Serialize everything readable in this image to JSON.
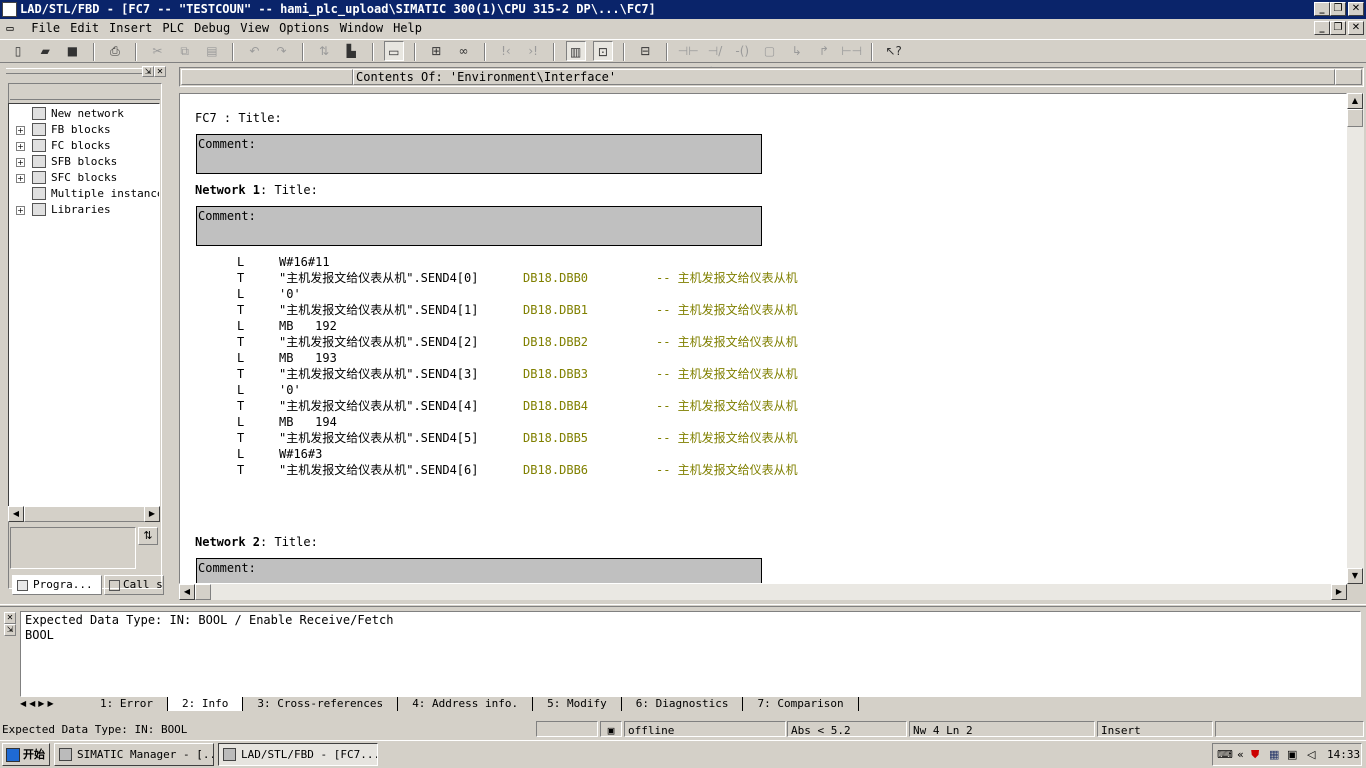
{
  "window": {
    "title": "LAD/STL/FBD  - [FC7 -- \"TESTCOUN\" -- hami_plc_upload\\SIMATIC 300(1)\\CPU 315-2 DP\\...\\FC7]"
  },
  "menu": {
    "items": [
      "File",
      "Edit",
      "Insert",
      "PLC",
      "Debug",
      "View",
      "Options",
      "Window",
      "Help"
    ]
  },
  "toolbar": {
    "icons": [
      "new-icon",
      "open-icon",
      "save-icon",
      "print-icon",
      "cut-icon",
      "copy-icon",
      "paste-icon",
      "undo-icon",
      "redo-icon",
      "load-icon",
      "download-icon",
      "overview-icon",
      "network-icon",
      "monitor-icon",
      "first-error-icon",
      "next-error-icon",
      "details-icon",
      "program-elements-icon",
      "new-network-icon",
      "contact-icon",
      "nc-contact-icon",
      "coil-icon",
      "branch-open-icon",
      "branch-close-icon",
      "connection-icon",
      "help-icon"
    ]
  },
  "tree": {
    "items": [
      {
        "label": "New network",
        "expandable": false
      },
      {
        "label": "FB blocks",
        "expandable": true
      },
      {
        "label": "FC blocks",
        "expandable": true
      },
      {
        "label": "SFB blocks",
        "expandable": true
      },
      {
        "label": "SFC blocks",
        "expandable": true
      },
      {
        "label": "Multiple instances",
        "expandable": false
      },
      {
        "label": "Libraries",
        "expandable": true
      }
    ],
    "tabs": [
      "Progra...",
      "Call s"
    ]
  },
  "interface_header": "Contents Of: 'Environment\\Interface'",
  "editor": {
    "block_title": "FC7 : Title:",
    "comment_label": "Comment:",
    "network1": {
      "label": "Network 1",
      "title": ": Title:"
    },
    "network2": {
      "label": "Network 2",
      "title": ": Title:"
    },
    "lines": [
      {
        "op": "L",
        "operand": "W#16#11",
        "address": "",
        "comment": ""
      },
      {
        "op": "T",
        "operand": "\"主机发报文给仪表从机\".SEND4[0]",
        "address": "DB18.DBB0",
        "comment": "-- 主机发报文给仪表从机"
      },
      {
        "op": "L",
        "operand": "'0'",
        "address": "",
        "comment": ""
      },
      {
        "op": "T",
        "operand": "\"主机发报文给仪表从机\".SEND4[1]",
        "address": "DB18.DBB1",
        "comment": "-- 主机发报文给仪表从机"
      },
      {
        "op": "L",
        "operand": "MB   192",
        "address": "",
        "comment": ""
      },
      {
        "op": "T",
        "operand": "\"主机发报文给仪表从机\".SEND4[2]",
        "address": "DB18.DBB2",
        "comment": "-- 主机发报文给仪表从机"
      },
      {
        "op": "L",
        "operand": "MB   193",
        "address": "",
        "comment": ""
      },
      {
        "op": "T",
        "operand": "\"主机发报文给仪表从机\".SEND4[3]",
        "address": "DB18.DBB3",
        "comment": "-- 主机发报文给仪表从机"
      },
      {
        "op": "L",
        "operand": "'0'",
        "address": "",
        "comment": ""
      },
      {
        "op": "T",
        "operand": "\"主机发报文给仪表从机\".SEND4[4]",
        "address": "DB18.DBB4",
        "comment": "-- 主机发报文给仪表从机"
      },
      {
        "op": "L",
        "operand": "MB   194",
        "address": "",
        "comment": ""
      },
      {
        "op": "T",
        "operand": "\"主机发报文给仪表从机\".SEND4[5]",
        "address": "DB18.DBB5",
        "comment": "-- 主机发报文给仪表从机"
      },
      {
        "op": "L",
        "operand": "W#16#3",
        "address": "",
        "comment": ""
      },
      {
        "op": "T",
        "operand": "\"主机发报文给仪表从机\".SEND4[6]",
        "address": "DB18.DBB6",
        "comment": "-- 主机发报文给仪表从机"
      }
    ]
  },
  "output": {
    "line1": "Expected Data Type: IN: BOOL / Enable Receive/Fetch",
    "line2": "BOOL",
    "tabs": [
      "1: Error",
      "2: Info",
      "3: Cross-references",
      "4: Address info.",
      "5: Modify",
      "6: Diagnostics",
      "7: Comparison"
    ],
    "active_tab": 1
  },
  "status": {
    "message": "Expected Data Type: IN: BOOL",
    "mode": "offline",
    "abs": "Abs < 5.2",
    "position": "Nw 4  Ln 2",
    "insert": "Insert"
  },
  "taskbar": {
    "start": "开始",
    "buttons": [
      {
        "label": "SIMATIC Manager - [...",
        "pressed": false
      },
      {
        "label": "LAD/STL/FBD  - [FC7...",
        "pressed": true
      }
    ],
    "clock": "14:33"
  }
}
